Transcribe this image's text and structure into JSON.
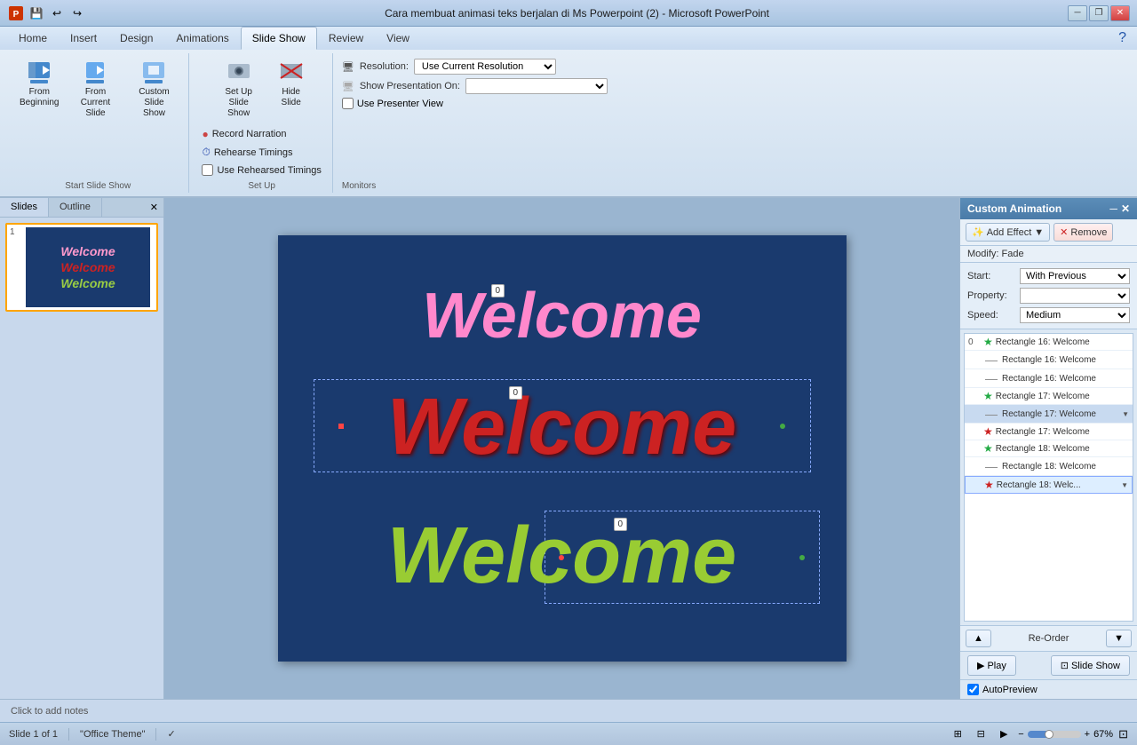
{
  "titlebar": {
    "title": "Cara membuat animasi teks berjalan di Ms Powerpoint (2) - Microsoft PowerPoint",
    "min": "─",
    "restore": "❐",
    "close": "✕"
  },
  "quickaccess": {
    "save": "💾",
    "undo": "↩",
    "redo": "↪"
  },
  "tabs": [
    "Home",
    "Insert",
    "Design",
    "Animations",
    "Slide Show",
    "Review",
    "View"
  ],
  "activeTab": "Slide Show",
  "groups": {
    "startSlideShow": {
      "label": "Start Slide Show",
      "fromBeginning": "From\nBeginning",
      "fromCurrentSlide": "From\nCurrent Slide",
      "customSlideShow": "Custom\nSlide Show",
      "setUpSlideShow": "Set Up\nSlide Show",
      "hideSlide": "Hide\nSlide"
    },
    "setUp": {
      "label": "Set Up",
      "recordNarration": "Record Narration",
      "rehearseTimings": "Rehearse Timings",
      "useRehearsedTimings": "Use Rehearsed Timings"
    },
    "monitors": {
      "label": "Monitors",
      "resolutionLabel": "Resolution:",
      "resolutionValue": "Use Current Resolution",
      "showPresentationOn": "Show Presentation On:",
      "showPresentationValue": "",
      "usePresenterView": "Use Presenter View"
    }
  },
  "slidepanel": {
    "tabs": [
      "Slides",
      "Outline"
    ],
    "slideNumber": "1",
    "welcomeColors": [
      "#ff88cc",
      "#cc2222",
      "#99cc33"
    ]
  },
  "canvas": {
    "badges": [
      "0",
      "0",
      "0"
    ],
    "texts": [
      "Welcome",
      "Welcome",
      "Welcome"
    ],
    "colors": [
      "#ff88cc",
      "#cc2222",
      "#99cc33"
    ]
  },
  "animationPanel": {
    "title": "Custom Animation",
    "addEffect": "Add Effect",
    "remove": "Remove",
    "modify": "Modify: Fade",
    "startLabel": "Start:",
    "startValue": "With Previous",
    "propertyLabel": "Property:",
    "speedLabel": "Speed:",
    "speedValue": "Medium",
    "items": [
      {
        "num": "0",
        "type": "star",
        "color": "green",
        "text": "Rectangle 16: Welcome",
        "hasDropdown": false
      },
      {
        "num": "",
        "type": "dash",
        "color": "",
        "text": "Rectangle 16: Welcome",
        "hasDropdown": false
      },
      {
        "num": "",
        "type": "dash",
        "color": "",
        "text": "Rectangle 16: Welcome",
        "hasDropdown": false
      },
      {
        "num": "",
        "type": "star",
        "color": "green",
        "text": "Rectangle 17: Welcome",
        "hasDropdown": false
      },
      {
        "num": "",
        "type": "dash",
        "color": "",
        "text": "Rectangle 17: Welcome",
        "hasDropdown": true,
        "selected": true
      },
      {
        "num": "",
        "type": "star",
        "color": "red",
        "text": "Rectangle 17: Welcome",
        "hasDropdown": false
      },
      {
        "num": "",
        "type": "star",
        "color": "green",
        "text": "Rectangle 18: Welcome",
        "hasDropdown": false
      },
      {
        "num": "",
        "type": "dash",
        "color": "",
        "text": "Rectangle 18: Welcome",
        "hasDropdown": false
      },
      {
        "num": "",
        "type": "star",
        "color": "red",
        "text": "Rectangle 18: Welc...",
        "hasDropdown": true,
        "highlighted": true
      }
    ],
    "reorder": "Re-Order",
    "play": "Play",
    "slideShow": "Slide Show",
    "autoPreview": "AutoPreview"
  },
  "notes": {
    "placeholder": "Click to add notes"
  },
  "statusbar": {
    "slideInfo": "Slide 1 of 1",
    "theme": "\"Office Theme\"",
    "zoom": "67%"
  }
}
